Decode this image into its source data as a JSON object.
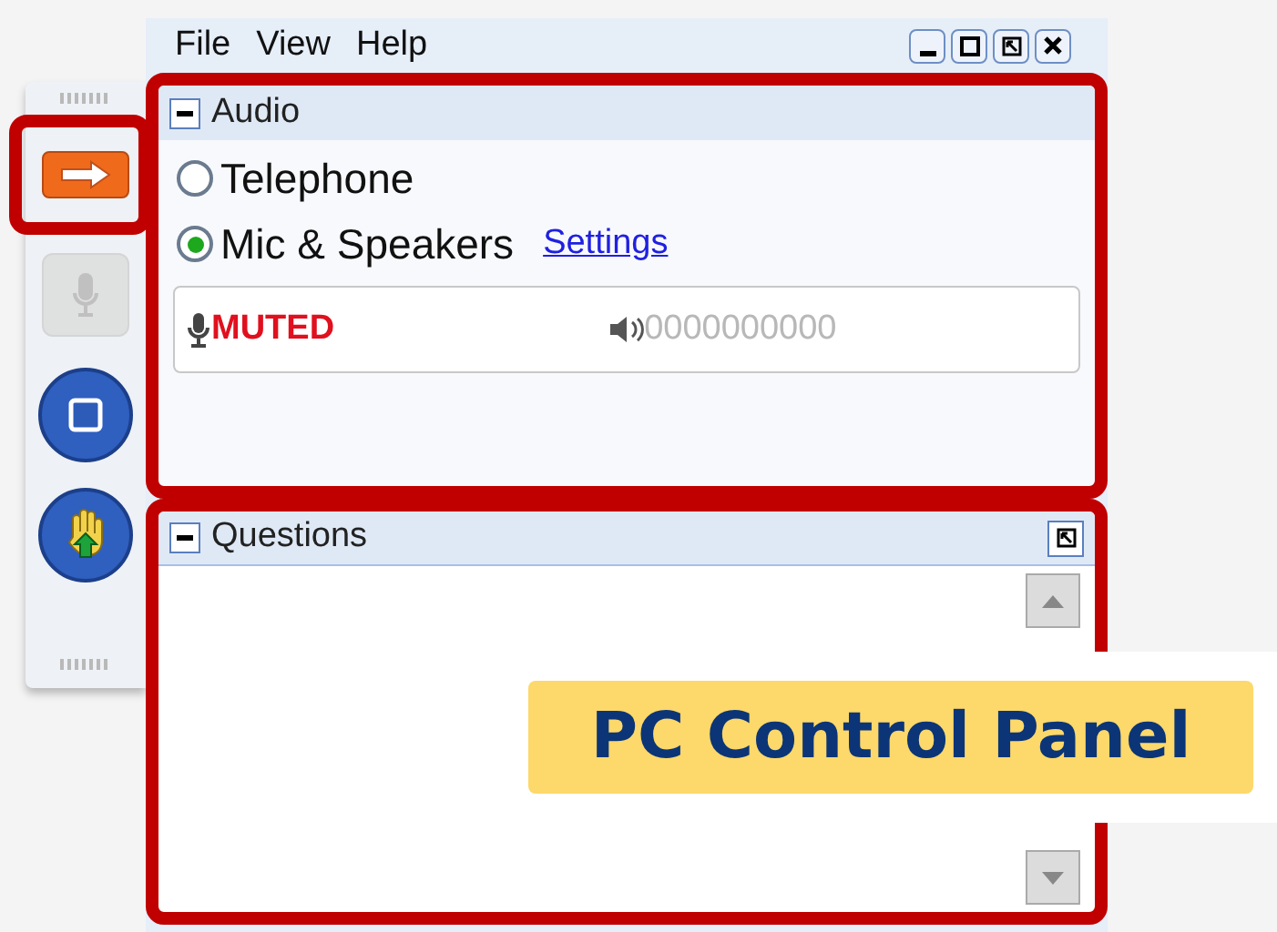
{
  "toolbar": [
    {
      "kind": "arrow",
      "disabled": false,
      "highlighted": true
    },
    {
      "kind": "mic",
      "disabled": true,
      "highlighted": false
    },
    {
      "kind": "screen",
      "disabled": false,
      "highlighted": false
    },
    {
      "kind": "hand",
      "disabled": false,
      "highlighted": false
    }
  ],
  "menu": [
    "File",
    "View",
    "Help"
  ],
  "audio": {
    "title": "Audio",
    "options": [
      {
        "label": "Telephone",
        "selected": false
      },
      {
        "label": "Mic & Speakers",
        "selected": true
      }
    ],
    "settings_link": "Settings",
    "mic_status": "MUTED",
    "speaker_meter": "0000000000"
  },
  "questions": {
    "title": "Questions"
  },
  "callout": "PC Control Panel"
}
